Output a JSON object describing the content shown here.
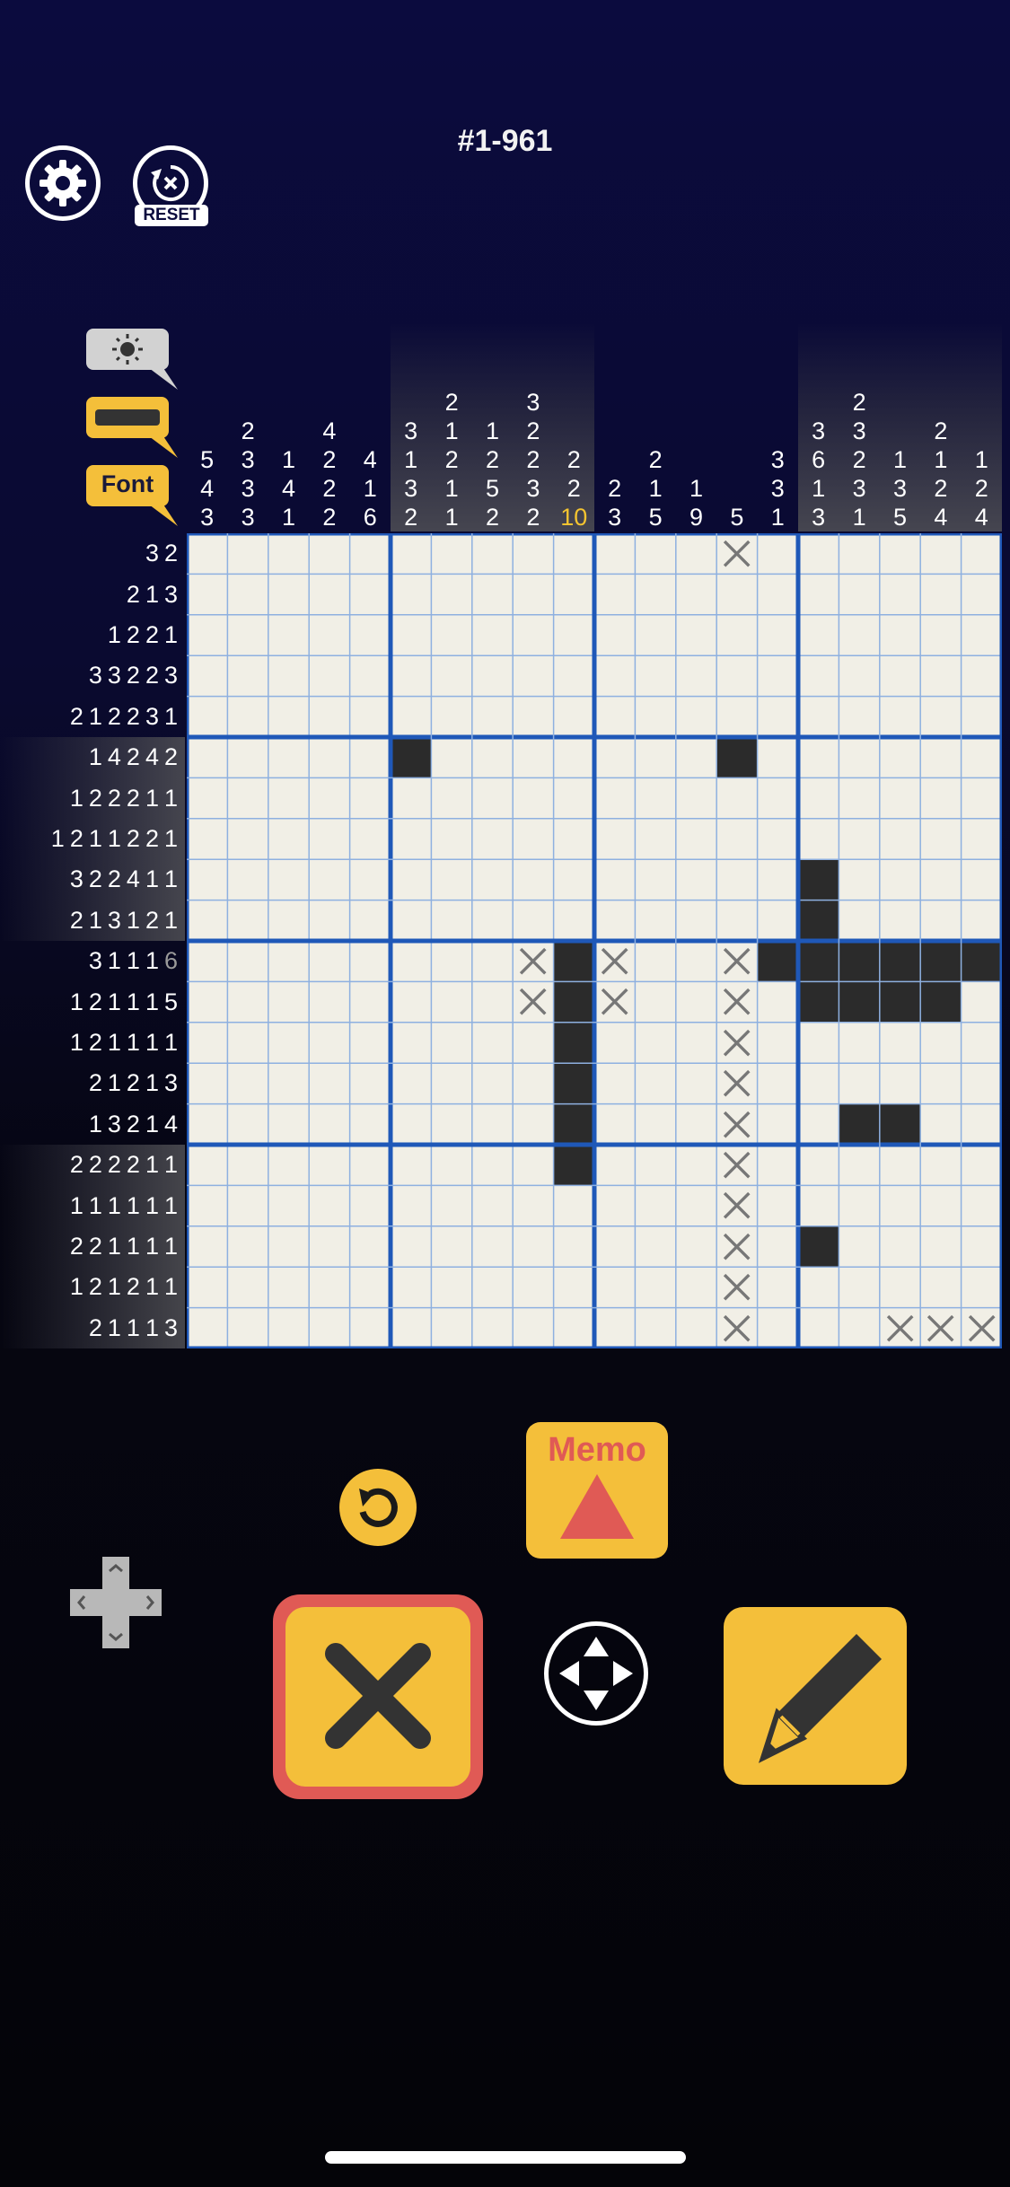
{
  "header": {
    "puzzle_id": "#1-961",
    "reset_label": "RESET"
  },
  "toolbar": {
    "font_label": "Font"
  },
  "controls": {
    "memo_label": "Memo"
  },
  "icons": [
    "gear-icon",
    "reset-icon",
    "brightness-icon",
    "color-bar-icon",
    "undo-icon",
    "memo-triangle-icon",
    "cross-icon",
    "move-icon",
    "pencil-icon",
    "dpad-icon"
  ],
  "colors": {
    "accent": "#f4bf3a",
    "cross_border": "#e05a55",
    "filled": "#2b2b2b",
    "grid_bg": "#f1efe6",
    "thick_line": "#1f58b8",
    "highlight_clue": "#f4c430"
  },
  "board": {
    "size": 20,
    "col_clues": [
      [
        "5",
        "4",
        "3"
      ],
      [
        "2",
        "3",
        "3",
        "3"
      ],
      [
        "1",
        "4",
        "1"
      ],
      [
        "4",
        "2",
        "2",
        "2"
      ],
      [
        "4",
        "1",
        "6"
      ],
      [
        "3",
        "1",
        "3",
        "2"
      ],
      [
        "2",
        "1",
        "2",
        "1",
        "1"
      ],
      [
        "1",
        "2",
        "5",
        "2"
      ],
      [
        "3",
        "2",
        "2",
        "3",
        "2"
      ],
      [
        "2",
        "2",
        "10"
      ],
      [
        "2",
        "3"
      ],
      [
        "2",
        "1",
        "5"
      ],
      [
        "1",
        "9"
      ],
      [
        "5"
      ],
      [
        "3",
        "3",
        "1"
      ],
      [
        "3",
        "6",
        "1",
        "3"
      ],
      [
        "2",
        "3",
        "2",
        "3",
        "1"
      ],
      [
        "1",
        "3",
        "5"
      ],
      [
        "2",
        "1",
        "2",
        "4"
      ],
      [
        "1",
        "2",
        "4"
      ]
    ],
    "row_clues": [
      [
        "3",
        "2"
      ],
      [
        "2",
        "1",
        "3"
      ],
      [
        "1",
        "2",
        "2",
        "1"
      ],
      [
        "3",
        "3",
        "2",
        "2",
        "3"
      ],
      [
        "2",
        "1",
        "2",
        "2",
        "3",
        "1"
      ],
      [
        "1",
        "4",
        "2",
        "4",
        "2"
      ],
      [
        "1",
        "2",
        "2",
        "2",
        "1",
        "1"
      ],
      [
        "1",
        "2",
        "1",
        "1",
        "2",
        "2",
        "1"
      ],
      [
        "3",
        "2",
        "2",
        "4",
        "1",
        "1"
      ],
      [
        "2",
        "1",
        "3",
        "1",
        "2",
        "1"
      ],
      [
        "3",
        "1",
        "1",
        "1",
        "6"
      ],
      [
        "1",
        "2",
        "1",
        "1",
        "1",
        "5"
      ],
      [
        "1",
        "2",
        "1",
        "1",
        "1",
        "1"
      ],
      [
        "2",
        "1",
        "2",
        "1",
        "3"
      ],
      [
        "1",
        "3",
        "2",
        "1",
        "4"
      ],
      [
        "2",
        "2",
        "2",
        "2",
        "1",
        "1"
      ],
      [
        "1",
        "1",
        "1",
        "1",
        "1",
        "1"
      ],
      [
        "2",
        "2",
        "1",
        "1",
        "1",
        "1"
      ],
      [
        "1",
        "2",
        "1",
        "2",
        "1",
        "1"
      ],
      [
        "2",
        "1",
        "1",
        "1",
        "3"
      ]
    ],
    "highlight": {
      "col": 9,
      "col_clue_index": 2,
      "row": 10,
      "row_clue_index": 4
    },
    "filled": [
      [
        5,
        5
      ],
      [
        5,
        13
      ],
      [
        8,
        15
      ],
      [
        9,
        15
      ],
      [
        10,
        9
      ],
      [
        10,
        14
      ],
      [
        10,
        15
      ],
      [
        10,
        16
      ],
      [
        10,
        17
      ],
      [
        10,
        18
      ],
      [
        10,
        19
      ],
      [
        11,
        9
      ],
      [
        11,
        15
      ],
      [
        11,
        16
      ],
      [
        11,
        17
      ],
      [
        11,
        18
      ],
      [
        12,
        9
      ],
      [
        13,
        9
      ],
      [
        14,
        9
      ],
      [
        15,
        9
      ],
      [
        14,
        16
      ],
      [
        14,
        17
      ],
      [
        17,
        15
      ]
    ],
    "crossed": [
      [
        0,
        13
      ],
      [
        10,
        8
      ],
      [
        10,
        10
      ],
      [
        10,
        13
      ],
      [
        11,
        8
      ],
      [
        11,
        10
      ],
      [
        11,
        13
      ],
      [
        12,
        13
      ],
      [
        13,
        13
      ],
      [
        14,
        13
      ],
      [
        15,
        13
      ],
      [
        16,
        13
      ],
      [
        17,
        13
      ],
      [
        18,
        13
      ],
      [
        19,
        13
      ],
      [
        19,
        17
      ],
      [
        19,
        18
      ],
      [
        19,
        19
      ]
    ]
  }
}
